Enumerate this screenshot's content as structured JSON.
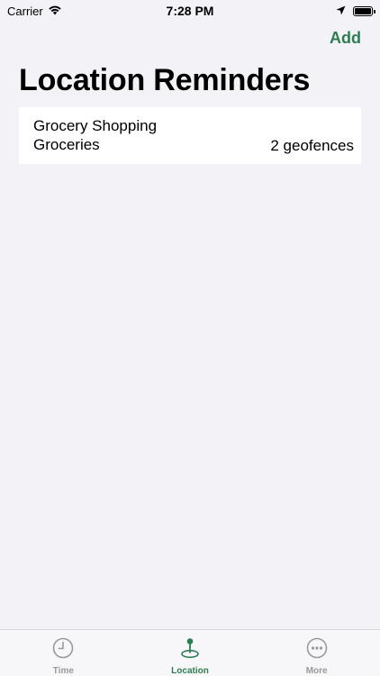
{
  "status_bar": {
    "carrier": "Carrier",
    "time": "7:28 PM"
  },
  "nav": {
    "add_label": "Add"
  },
  "page": {
    "title": "Location Reminders"
  },
  "reminders": [
    {
      "title": "Grocery Shopping",
      "subtitle": "Groceries",
      "detail": "2 geofences"
    }
  ],
  "tab_bar": {
    "tabs": [
      {
        "label": "Time",
        "icon": "clock-icon",
        "active": false
      },
      {
        "label": "Location",
        "icon": "location-pin-icon",
        "active": true
      },
      {
        "label": "More",
        "icon": "more-icon",
        "active": false
      }
    ]
  },
  "colors": {
    "accent": "#2e7d52",
    "background": "#f2f2f7",
    "inactive_tab": "#999999"
  }
}
